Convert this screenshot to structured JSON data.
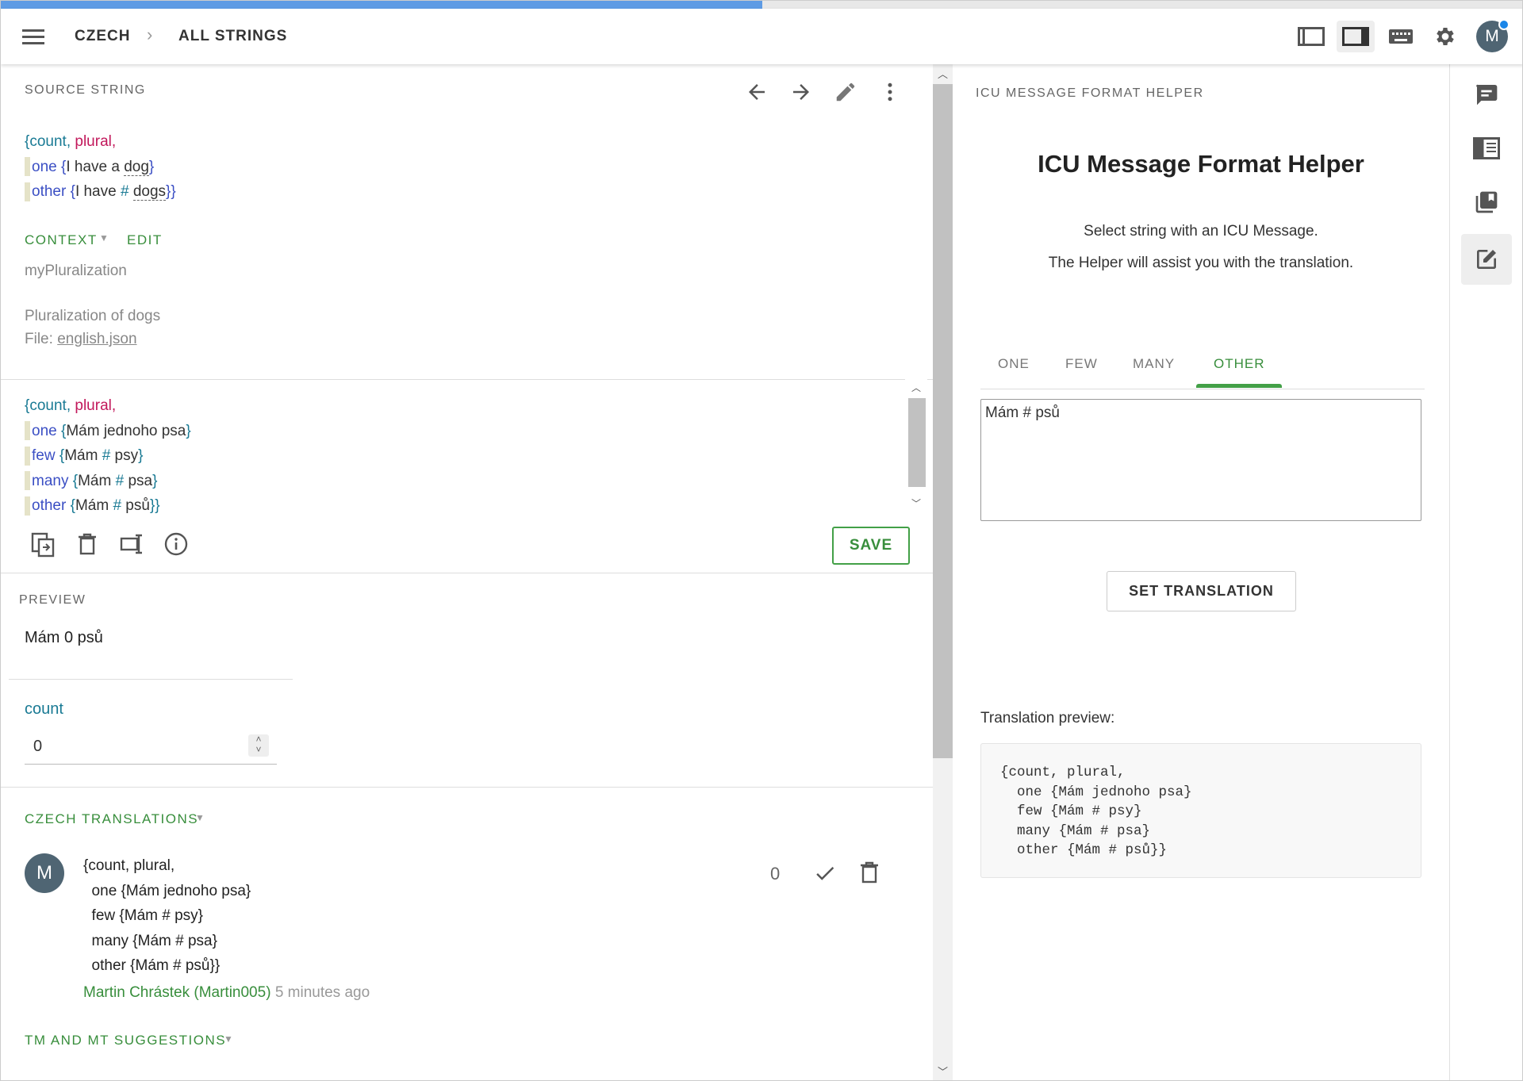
{
  "progress_percent": 50,
  "header": {
    "breadcrumb_locale": "CZECH",
    "breadcrumb_view": "ALL STRINGS",
    "avatar_initial": "M"
  },
  "source": {
    "label": "SOURCE STRING",
    "open": "{count",
    "comma1": ", ",
    "plural": "plural",
    "comma2": ",",
    "one_key": "one",
    "one_open": " {",
    "one_text1": "I have a ",
    "one_dog": "dog",
    "one_close": "}",
    "other_key": "other",
    "other_open": " {",
    "other_text1": "I have ",
    "other_hash": "#",
    "other_space": " ",
    "other_dogs": "dogs",
    "other_close": "}}",
    "context_label": "CONTEXT",
    "edit_label": "EDIT",
    "context_key": "myPluralization",
    "comment": "Pluralization of dogs",
    "file_prefix": "File: ",
    "file_name": "english.json"
  },
  "editor": {
    "open": "{count",
    "comma1": ", ",
    "plural": "plural",
    "comma2": ",",
    "rows": [
      {
        "key": "one",
        "open": " {",
        "pre": "Mám jednoho psa",
        "hash": "",
        "post": "",
        "close": "}"
      },
      {
        "key": "few",
        "open": " {",
        "pre": "Mám ",
        "hash": "#",
        "post": " psy",
        "close": "}"
      },
      {
        "key": "many",
        "open": " {",
        "pre": "Mám ",
        "hash": "#",
        "post": " psa",
        "close": "}"
      },
      {
        "key": "other",
        "open": " {",
        "pre": "Mám ",
        "hash": "#",
        "post": " psů",
        "close": "}}"
      }
    ],
    "save_label": "SAVE"
  },
  "preview": {
    "label": "PREVIEW",
    "text": "Mám 0 psů",
    "var_name": "count",
    "var_value": "0"
  },
  "translations": {
    "label": "CZECH TRANSLATIONS",
    "item": {
      "avatar": "M",
      "lines": [
        "{count, plural,",
        "  one {Mám jednoho psa}",
        "  few {Mám # psy}",
        "  many {Mám # psa}",
        "  other {Mám # psů}}"
      ],
      "votes": "0",
      "author": "Martin Chrástek (Martin005)",
      "time": "5 minutes ago"
    }
  },
  "suggestions": {
    "label": "TM AND MT SUGGESTIONS"
  },
  "helper": {
    "section_label": "ICU MESSAGE FORMAT HELPER",
    "title": "ICU Message Format Helper",
    "subtitle1": "Select string with an ICU Message.",
    "subtitle2": "The Helper will assist you with the translation.",
    "tabs": [
      "ONE",
      "FEW",
      "MANY",
      "OTHER"
    ],
    "active_tab": "OTHER",
    "textarea_value": "Mám # psů",
    "set_translation": "SET TRANSLATION",
    "preview_label": "Translation preview:",
    "preview_lines": [
      "{count, plural,",
      "  one {Mám jednoho psa}",
      "  few {Mám # psy}",
      "  many {Mám # psa}",
      "  other {Mám # psů}}"
    ]
  },
  "colors": {
    "green": "#388e3c",
    "teal": "#197a94",
    "pink": "#c2185b",
    "blue": "#3b4fc4",
    "progress": "#5e9be4"
  }
}
